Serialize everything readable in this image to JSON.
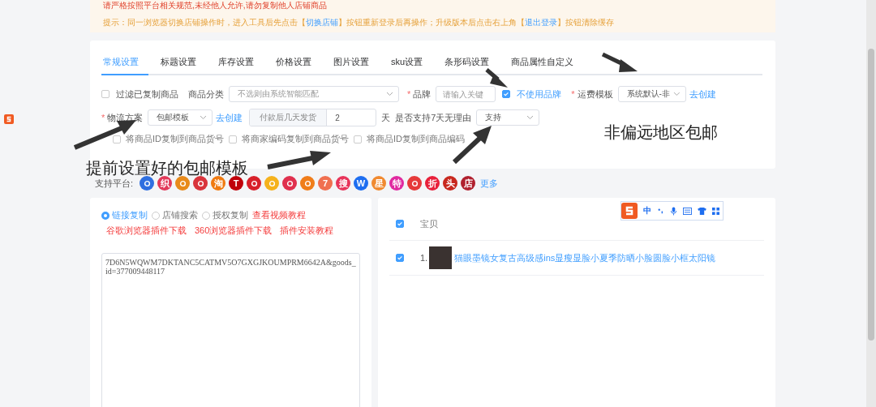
{
  "notice": {
    "warning": "请严格按照平台相关规范,未经他人允许,请勿复制他人店铺商品",
    "hint": [
      {
        "kind": "text",
        "text": "提示：同一浏览器切换店铺操作时，进入工具后先点击【"
      },
      {
        "kind": "link",
        "text": "切换店铺"
      },
      {
        "kind": "text",
        "text": "】按钮重新登录后再操作；升级版本后点击右上角【"
      },
      {
        "kind": "link",
        "text": "退出登录"
      },
      {
        "kind": "text",
        "text": "】按钮清除缓存"
      }
    ]
  },
  "tabs": [
    {
      "label": "常规设置",
      "selected": true
    },
    {
      "label": "标题设置",
      "selected": false
    },
    {
      "label": "库存设置",
      "selected": false
    },
    {
      "label": "价格设置",
      "selected": false
    },
    {
      "label": "图片设置",
      "selected": false
    },
    {
      "label": "sku设置",
      "selected": false
    },
    {
      "label": "条形码设置",
      "selected": false
    },
    {
      "label": "商品属性自定义",
      "selected": false
    }
  ],
  "form": {
    "filter_copied": {
      "label": "过滤已复制商品",
      "checked": false
    },
    "category": {
      "label": "商品分类",
      "placeholder": "不选则由系统智能匹配"
    },
    "brand": {
      "label": "品牌",
      "required_mark": "*",
      "placeholder": "请输入关键"
    },
    "no_brand": {
      "label": "不使用品牌",
      "checked": true
    },
    "freight": {
      "label": "运费模板",
      "required_mark": "*",
      "value": "系统默认-非",
      "link": "去创建"
    },
    "logistics": {
      "label": "物流方案",
      "required_mark": "*",
      "value": "包邮模板",
      "link": "去创建"
    },
    "ship_days": {
      "prefix": "付款后几天发货",
      "value": "2",
      "unit": "天"
    },
    "return7": {
      "label": "是否支持7天无理由",
      "value": "支持"
    },
    "options": [
      {
        "label": "将商品ID复制到商品货号",
        "checked": false
      },
      {
        "label": "将商家编码复制到商品货号",
        "checked": false
      },
      {
        "label": "将商品ID复制到商品编码",
        "checked": false
      }
    ]
  },
  "platforms": {
    "label": "支持平台:",
    "more": "更多",
    "items": [
      {
        "color": "#2f6fe0"
      },
      {
        "glyph": "织",
        "color": "#e23a5a"
      },
      {
        "color": "#e88a1a"
      },
      {
        "color": "#d9343c"
      },
      {
        "glyph": "淘",
        "color": "#f07a10"
      },
      {
        "glyph": "T",
        "color": "#c0000a"
      },
      {
        "color": "#d8202a"
      },
      {
        "color": "#f5b21c"
      },
      {
        "color": "#e0304e"
      },
      {
        "color": "#f07d1a"
      },
      {
        "glyph": "7",
        "color": "#f07050"
      },
      {
        "glyph": "搜",
        "color": "#e8345a"
      },
      {
        "glyph": "W",
        "color": "#1e6ef0"
      },
      {
        "glyph": "星",
        "color": "#f08a30"
      },
      {
        "glyph": "特",
        "color": "#e02aa0"
      },
      {
        "color": "#e63a3a"
      },
      {
        "glyph": "折",
        "color": "#e8203a"
      },
      {
        "glyph": "头",
        "color": "#c8281e"
      },
      {
        "glyph": "店",
        "color": "#b0202e"
      }
    ]
  },
  "copy_panel": {
    "modes": [
      {
        "label": "链接复制",
        "selected": true
      },
      {
        "label": "店铺搜索",
        "selected": false
      },
      {
        "label": "授权复制",
        "selected": false
      }
    ],
    "links": [
      "查看视频教程",
      "谷歌浏览器插件下载",
      "360浏览器插件下载",
      "插件安装教程"
    ],
    "url_value": "7D6N5WQWM7DKTANC5CATMV5O7GXGJKOUMPRM6642A&goods_id=377009448117"
  },
  "goods_panel": {
    "header": {
      "label": "宝贝",
      "checked": true
    },
    "rows": [
      {
        "index": "1.",
        "title": "猫眼墨镜女复古高级感ins显瘦显脸小夏季防晒小脸圆脸小框太阳镜",
        "checked": true
      }
    ]
  },
  "ime_toolbar": {
    "mode": "中"
  },
  "annotations": [
    "非偏远地区包邮",
    "提前设置好的包邮模板"
  ]
}
